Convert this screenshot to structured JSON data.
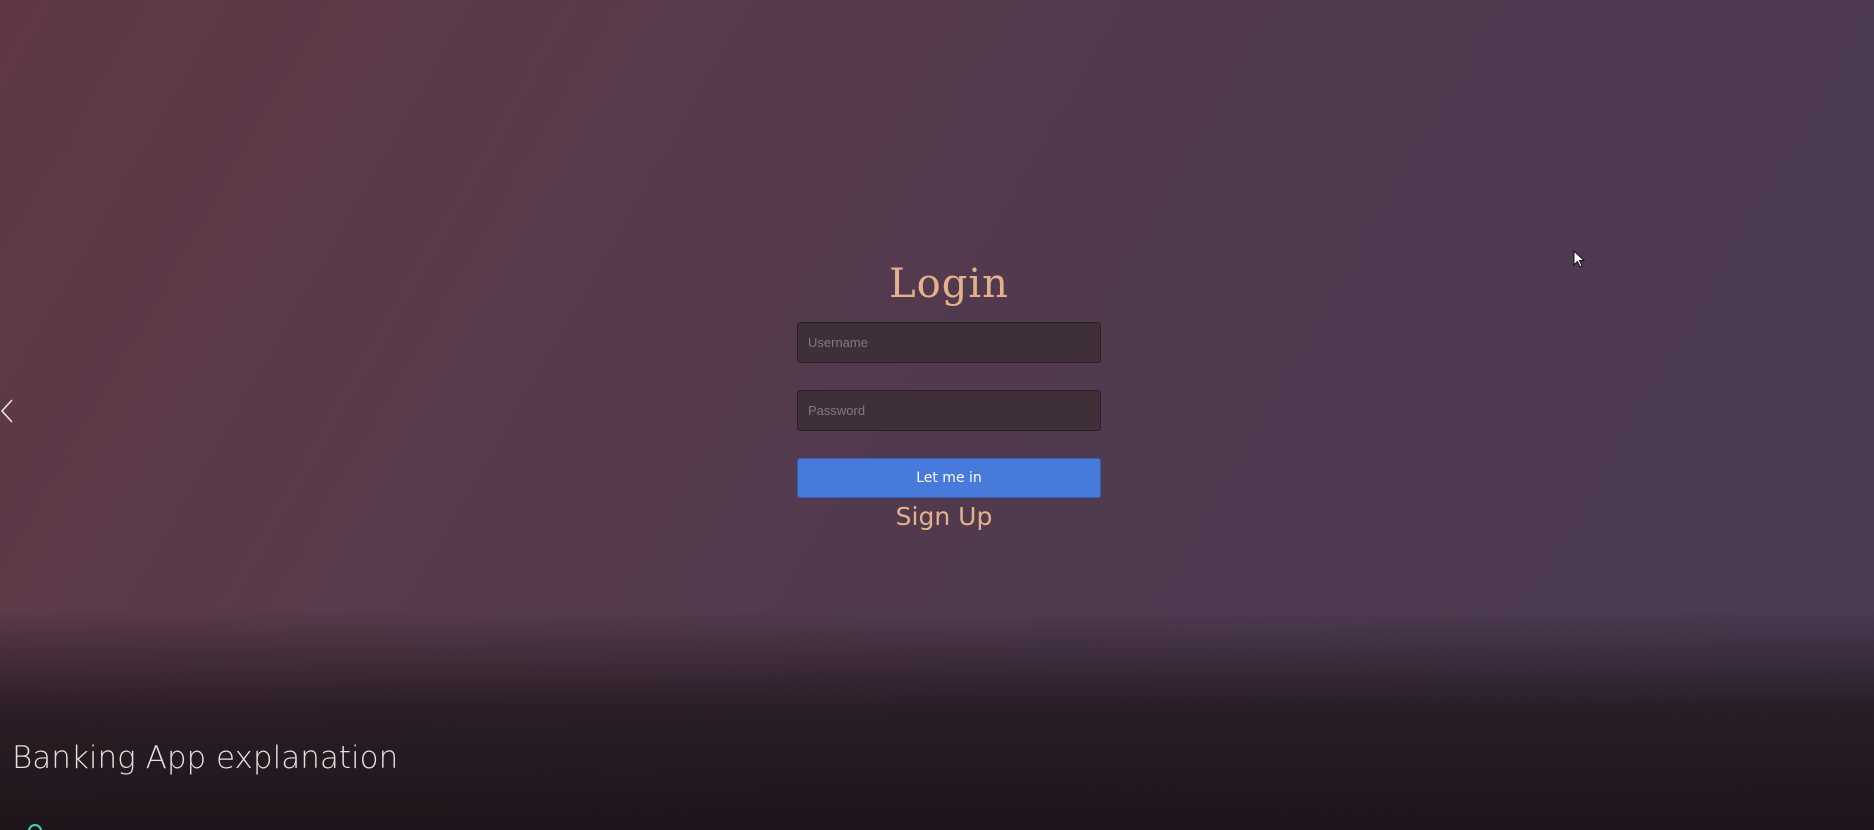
{
  "login": {
    "title": "Login",
    "username_placeholder": "Username",
    "password_placeholder": "Password",
    "submit_label": "Let me in",
    "signup_label": "Sign Up"
  },
  "video": {
    "title": "Banking App explanation"
  },
  "icons": {
    "back": "chevron-left-icon",
    "cursor": "mouse-pointer-icon",
    "indicator": "circle-indicator-icon"
  },
  "colors": {
    "accent_text": "#e3b28c",
    "button": "#477adb",
    "indicator": "#3fd7b3"
  }
}
